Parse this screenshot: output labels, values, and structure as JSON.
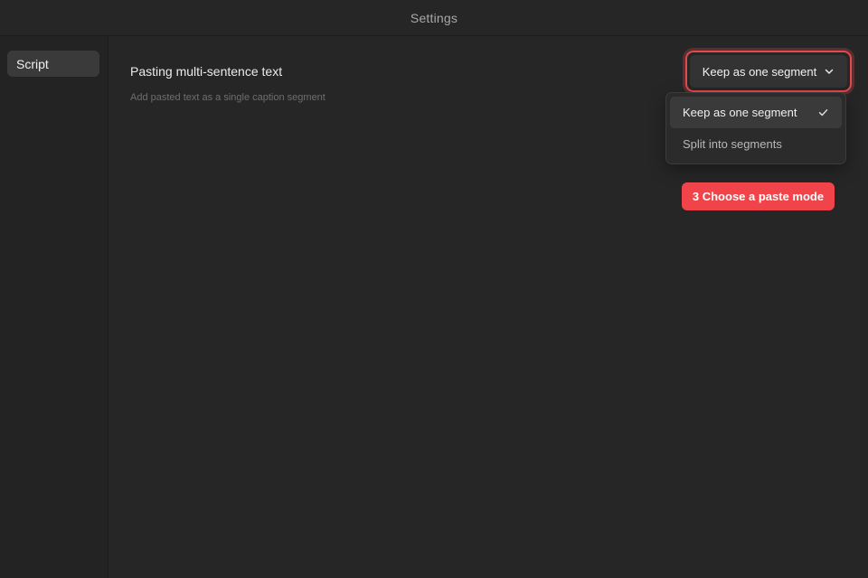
{
  "window": {
    "title": "Settings"
  },
  "sidebar": {
    "items": [
      {
        "label": "Script",
        "icon": ""
      }
    ]
  },
  "setting": {
    "label": "Pasting multi-sentence text",
    "description": "Add pasted text as a single caption segment",
    "select": {
      "value": "Keep as one segment",
      "icon": "chevron-down-icon"
    },
    "options": [
      {
        "label": "Keep as one segment",
        "selected": true,
        "icon": "check-icon"
      },
      {
        "label": "Split into segments",
        "selected": false
      }
    ]
  },
  "annotation": {
    "label": "3 Choose a paste mode"
  },
  "colors": {
    "accent": "#e5484d",
    "badge": "#f0444a",
    "background": "#262626",
    "sidebar": "#232323"
  }
}
